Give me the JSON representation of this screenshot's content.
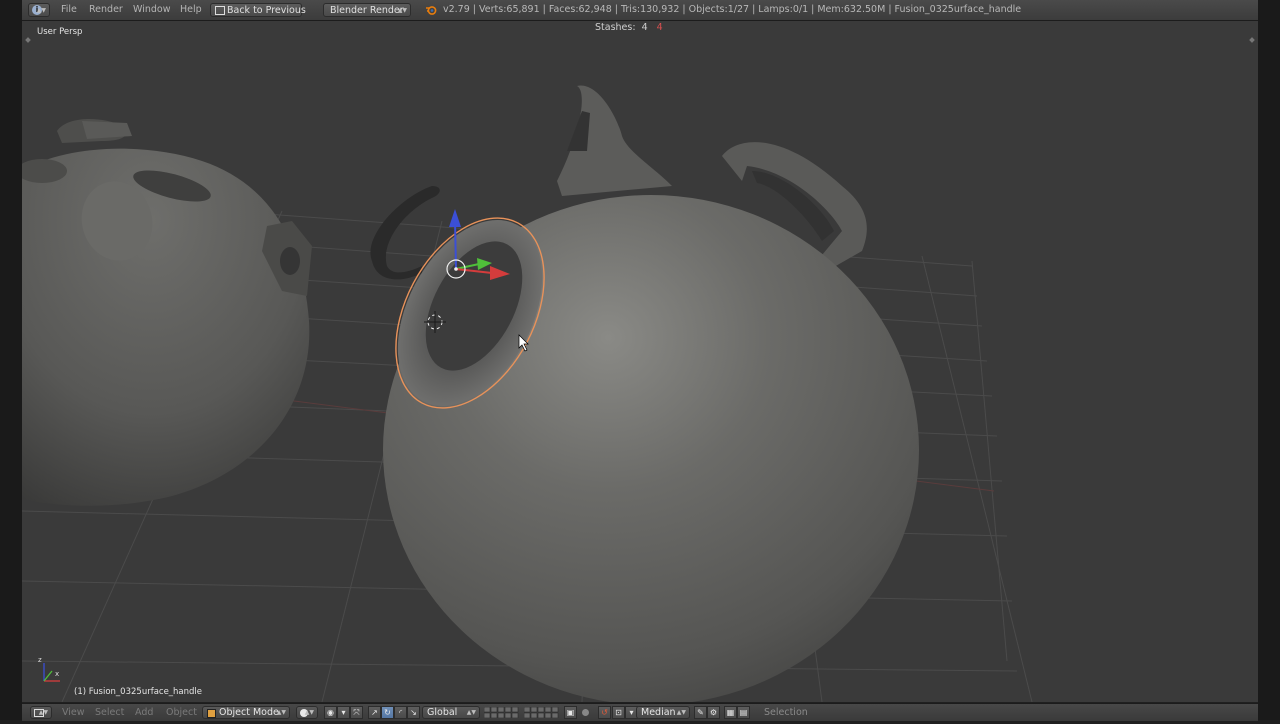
{
  "header": {
    "menus": [
      "File",
      "Render",
      "Window",
      "Help"
    ],
    "back_button": "Back to Previous",
    "render_engine": "Blender Render",
    "stats": "v2.79 | Verts:65,891 | Faces:62,948 | Tris:130,932 | Objects:1/27 | Lamps:0/1 | Mem:632.50M | Fusion_0325urface_handle"
  },
  "viewport": {
    "view_label": "User Persp",
    "stashes_label": "Stashes:",
    "stashes_count": "4",
    "stashes_count_red": "4",
    "object_label": "(1) Fusion_0325urface_handle"
  },
  "footer": {
    "menus": [
      "View",
      "Select",
      "Add",
      "Object"
    ],
    "mode": "Object Mode",
    "orientation": "Global",
    "pivot": "Median",
    "status": "Selection"
  },
  "colors": {
    "viewport_bg": "#3a3a3a",
    "object_body": "#6a6a68",
    "selection_outline": "#e8925a",
    "gizmo_x": "#d43c3c",
    "gizmo_y": "#4fbf3a",
    "gizmo_z": "#3b4fd6"
  },
  "icons": [
    "info-icon",
    "blender-logo-icon",
    "cursor-icon",
    "view-menu-icon",
    "shading-solid-icon",
    "manipulator-icon",
    "layer-grid-icon",
    "lock-icon",
    "proportional-edit-icon",
    "snap-magnet-icon",
    "render-icon"
  ]
}
